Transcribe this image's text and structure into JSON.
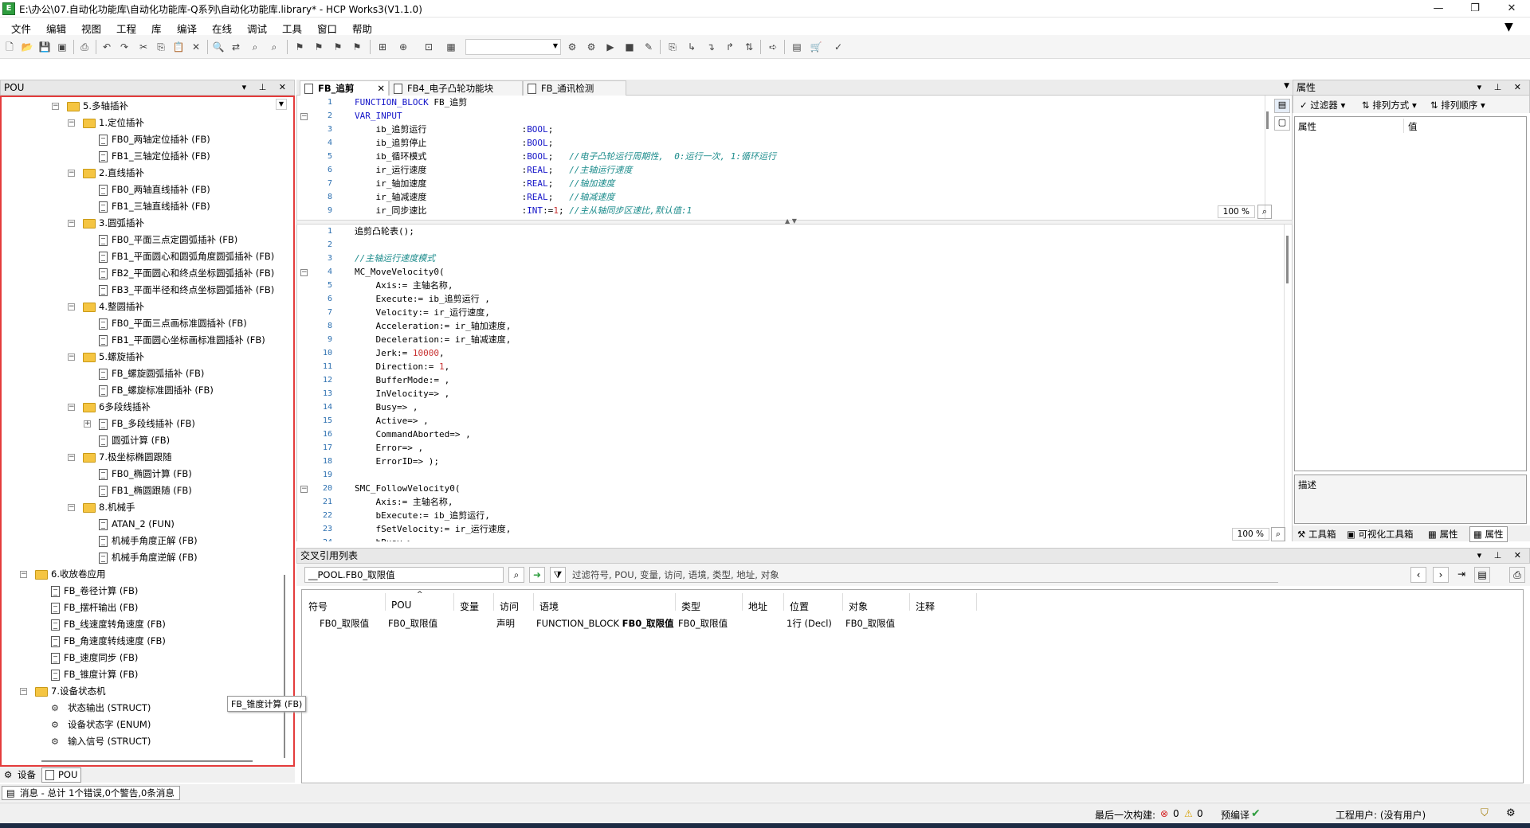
{
  "window": {
    "title": "E:\\办公\\07.自动化功能库\\自动化功能库-Q系列\\自动化功能库.library* - HCP Works3(V1.1.0)",
    "icon_label": "E"
  },
  "menu": [
    "文件",
    "编辑",
    "视图",
    "工程",
    "库",
    "编译",
    "在线",
    "调试",
    "工具",
    "窗口",
    "帮助"
  ],
  "pou_panel": {
    "title": "POU",
    "tree": [
      {
        "label": "5.多轴插补",
        "type": "folder",
        "level": 1,
        "expanded": true
      },
      {
        "label": "1.定位插补",
        "type": "folder",
        "level": 2,
        "expanded": true
      },
      {
        "label": "FB0_两轴定位插补 (FB)",
        "type": "fb",
        "level": 3
      },
      {
        "label": "FB1_三轴定位插补 (FB)",
        "type": "fb",
        "level": 3
      },
      {
        "label": "2.直线插补",
        "type": "folder",
        "level": 2,
        "expanded": true
      },
      {
        "label": "FB0_两轴直线插补 (FB)",
        "type": "fb",
        "level": 3
      },
      {
        "label": "FB1_三轴直线插补 (FB)",
        "type": "fb",
        "level": 3
      },
      {
        "label": "3.圆弧插补",
        "type": "folder",
        "level": 2,
        "expanded": true
      },
      {
        "label": "FB0_平面三点定圆弧插补 (FB)",
        "type": "fb",
        "level": 3
      },
      {
        "label": "FB1_平面圆心和圆弧角度圆弧插补 (FB)",
        "type": "fb",
        "level": 3
      },
      {
        "label": "FB2_平面圆心和终点坐标圆弧插补 (FB)",
        "type": "fb",
        "level": 3
      },
      {
        "label": "FB3_平面半径和终点坐标圆弧插补 (FB)",
        "type": "fb",
        "level": 3
      },
      {
        "label": "4.整圆插补",
        "type": "folder",
        "level": 2,
        "expanded": true
      },
      {
        "label": "FB0_平面三点画标准圆插补 (FB)",
        "type": "fb",
        "level": 3
      },
      {
        "label": "FB1_平面圆心坐标画标准圆插补 (FB)",
        "type": "fb",
        "level": 3
      },
      {
        "label": "5.螺旋插补",
        "type": "folder",
        "level": 2,
        "expanded": true
      },
      {
        "label": "FB_螺旋圆弧插补 (FB)",
        "type": "fb",
        "level": 3
      },
      {
        "label": "FB_螺旋标准圆插补 (FB)",
        "type": "fb",
        "level": 3
      },
      {
        "label": "6多段线插补",
        "type": "folder",
        "level": 2,
        "expanded": true
      },
      {
        "label": "FB_多段线插补 (FB)",
        "type": "fb",
        "level": 3,
        "collapsed_child": true
      },
      {
        "label": "圆弧计算 (FB)",
        "type": "fb",
        "level": 3
      },
      {
        "label": "7.极坐标椭圆跟随",
        "type": "folder",
        "level": 2,
        "expanded": true
      },
      {
        "label": "FB0_椭圆计算 (FB)",
        "type": "fb",
        "level": 3
      },
      {
        "label": "FB1_椭圆跟随 (FB)",
        "type": "fb",
        "level": 3
      },
      {
        "label": "8.机械手",
        "type": "folder",
        "level": 2,
        "expanded": true
      },
      {
        "label": "ATAN_2 (FUN)",
        "type": "fb",
        "level": 3
      },
      {
        "label": "机械手角度正解 (FB)",
        "type": "fb",
        "level": 3
      },
      {
        "label": "机械手角度逆解 (FB)",
        "type": "fb",
        "level": 3
      },
      {
        "label": "6.收放卷应用",
        "type": "folder",
        "level": 1,
        "expanded": true
      },
      {
        "label": "FB_卷径计算 (FB)",
        "type": "fb",
        "level": 2
      },
      {
        "label": "FB_摆杆输出 (FB)",
        "type": "fb",
        "level": 2
      },
      {
        "label": "FB_线速度转角速度 (FB)",
        "type": "fb",
        "level": 2
      },
      {
        "label": "FB_角速度转线速度 (FB)",
        "type": "fb",
        "level": 2
      },
      {
        "label": "FB_速度同步 (FB)",
        "type": "fb",
        "level": 2
      },
      {
        "label": "FB_锥度计算 (FB)",
        "type": "fb",
        "level": 2
      },
      {
        "label": "7.设备状态机",
        "type": "folder",
        "level": 1,
        "expanded": true
      },
      {
        "label": "状态输出 (STRUCT)",
        "type": "struct",
        "level": 2
      },
      {
        "label": "设备状态字 (ENUM)",
        "type": "struct",
        "level": 2
      },
      {
        "label": "输入信号 (STRUCT)",
        "type": "struct",
        "level": 2
      }
    ],
    "tooltip": "FB_锥度计算 (FB)",
    "bottom_tabs": [
      "设备",
      "POU"
    ]
  },
  "editor": {
    "tabs": [
      "FB_追剪",
      "FB4_电子凸轮功能块",
      "FB_通讯检测"
    ],
    "decl_lines": [
      {
        "n": "1",
        "t": "FUNCTION_BLOCK FB_追剪"
      },
      {
        "n": "2",
        "t": "VAR_INPUT"
      },
      {
        "n": "3",
        "t": "    ib_追剪运行                  :BOOL;"
      },
      {
        "n": "4",
        "t": "    ib_追剪停止                  :BOOL;"
      },
      {
        "n": "5",
        "t": "    ib_循环模式                  :BOOL;   //电子凸轮运行周期性,  0:运行一次, 1:循环运行"
      },
      {
        "n": "6",
        "t": "    ir_运行速度                  :REAL;   //主轴运行速度"
      },
      {
        "n": "7",
        "t": "    ir_轴加速度                  :REAL;   //轴加速度"
      },
      {
        "n": "8",
        "t": "    ir_轴减速度                  :REAL;   //轴减速度"
      },
      {
        "n": "9",
        "t": "    ir_同步速比                  :INT:=1; //主从轴同步区速比,默认值:1"
      }
    ],
    "impl_lines": [
      {
        "n": "1",
        "t": "追剪凸轮表();"
      },
      {
        "n": "2",
        "t": ""
      },
      {
        "n": "3",
        "t": "//主轴运行速度模式"
      },
      {
        "n": "4",
        "t": "MC_MoveVelocity0("
      },
      {
        "n": "5",
        "t": "    Axis:= 主轴名称,"
      },
      {
        "n": "6",
        "t": "    Execute:= ib_追剪运行 ,"
      },
      {
        "n": "7",
        "t": "    Velocity:= ir_运行速度,"
      },
      {
        "n": "8",
        "t": "    Acceleration:= ir_轴加速度,"
      },
      {
        "n": "9",
        "t": "    Deceleration:= ir_轴减速度,"
      },
      {
        "n": "10",
        "t": "    Jerk:= 10000,"
      },
      {
        "n": "11",
        "t": "    Direction:= 1,"
      },
      {
        "n": "12",
        "t": "    BufferMode:= ,"
      },
      {
        "n": "13",
        "t": "    InVelocity=> ,"
      },
      {
        "n": "14",
        "t": "    Busy=> ,"
      },
      {
        "n": "15",
        "t": "    Active=> ,"
      },
      {
        "n": "16",
        "t": "    CommandAborted=> ,"
      },
      {
        "n": "17",
        "t": "    Error=> ,"
      },
      {
        "n": "18",
        "t": "    ErrorID=> );"
      },
      {
        "n": "19",
        "t": ""
      },
      {
        "n": "20",
        "t": "SMC_FollowVelocity0("
      },
      {
        "n": "21",
        "t": "    Axis:= 主轴名称,"
      },
      {
        "n": "22",
        "t": "    bExecute:= ib_追剪运行,"
      },
      {
        "n": "23",
        "t": "    fSetVelocity:= ir_运行速度,"
      },
      {
        "n": "24",
        "t": "    bBusy=>"
      }
    ],
    "zoom_top": "100 %",
    "zoom_bottom": "100 %"
  },
  "properties": {
    "title": "属性",
    "filter": "过滤器",
    "sort_by": "排列方式",
    "sort_order": "排列顺序",
    "col_prop": "属性",
    "col_value": "值",
    "desc": "描述",
    "bottom_tabs": [
      "工具箱",
      "可视化工具箱",
      "属性",
      "属性"
    ]
  },
  "xref": {
    "title": "交叉引用列表",
    "search_value": "__POOL.FB0_取限值",
    "filter_placeholder": "过滤符号, POU, 变量, 访问, 语境, 类型, 地址, 对象",
    "columns": [
      "符号",
      "POU",
      "变量",
      "访问",
      "语境",
      "类型",
      "地址",
      "位置",
      "对象",
      "注释"
    ],
    "row": {
      "symbol": "FB0_取限值",
      "pou": "FB0_取限值",
      "var": "",
      "access": "声明",
      "context_pre": "FUNCTION_BLOCK ",
      "context_bold": "FB0_取限值",
      "type": "FB0_取限值",
      "addr": "",
      "location": "1行 (Decl)",
      "object": "FB0_取限值",
      "comment": ""
    }
  },
  "messages": {
    "text": "消息 - 总计 1个错误,0个警告,0条消息"
  },
  "status": {
    "last_build": "最后一次构建:",
    "errors": "0",
    "warnings": "0",
    "precompile": "预编译",
    "user": "工程用户: (没有用户)"
  },
  "colors": {
    "highlight": "#e43c3c",
    "keyword": "#1414c8",
    "comment": "#1c8c8c",
    "linenum": "#2b6fb0"
  }
}
